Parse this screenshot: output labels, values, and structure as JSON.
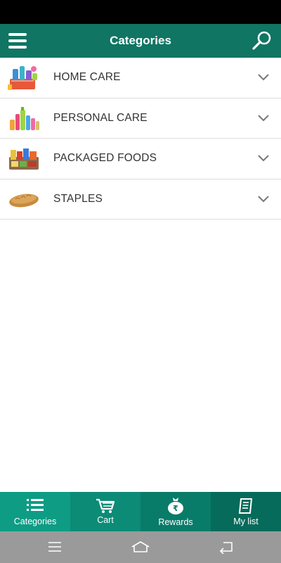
{
  "header": {
    "title": "Categories",
    "menu_icon": "hamburger-menu-icon",
    "search_icon": "search-icon",
    "color": "#107563"
  },
  "categories": [
    {
      "label": "HOME CARE",
      "icon": "home-care-products-image"
    },
    {
      "label": "PERSONAL CARE",
      "icon": "personal-care-products-image"
    },
    {
      "label": "PACKAGED FOODS",
      "icon": "packaged-foods-image"
    },
    {
      "label": "STAPLES",
      "icon": "bread-loaf-image"
    }
  ],
  "bottom_nav": {
    "items": [
      {
        "label": "Categories",
        "icon": "list-icon",
        "color": "#0e9c85",
        "active": true
      },
      {
        "label": "Cart",
        "icon": "cart-icon",
        "color": "#0c8b77"
      },
      {
        "label": "Rewards",
        "icon": "money-bag-icon",
        "color": "#097b69"
      },
      {
        "label": "My list",
        "icon": "checklist-icon",
        "color": "#066b5a"
      }
    ]
  },
  "system_nav": {
    "buttons": [
      "menu-icon",
      "home-icon",
      "back-icon"
    ],
    "color": "#9a9a9a"
  }
}
